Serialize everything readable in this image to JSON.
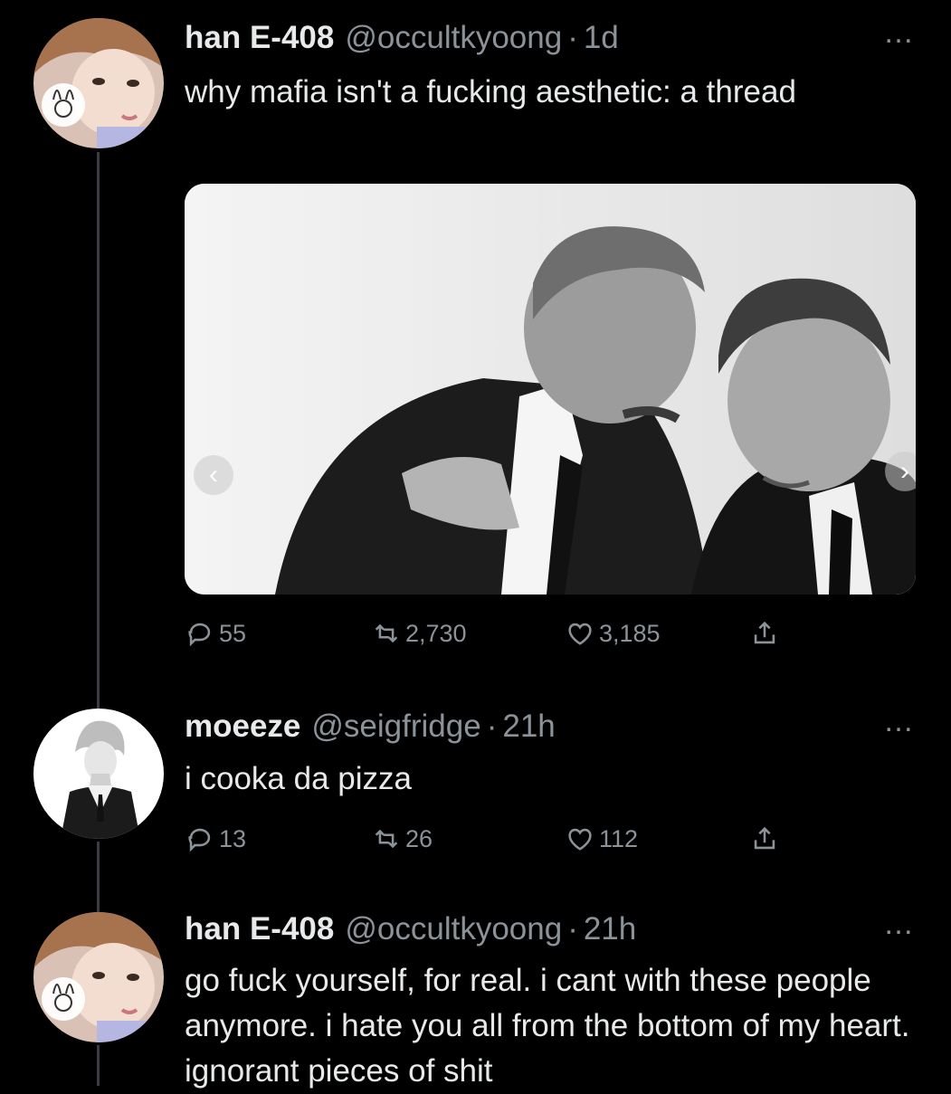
{
  "tweets": [
    {
      "name": "han E-408",
      "handle": "@occultkyoong",
      "sep": "·",
      "time": "1d",
      "text": "why mafia isn't a fucking aesthetic: a thread",
      "stats": {
        "replies": "55",
        "retweets": "2,730",
        "likes": "3,185"
      }
    },
    {
      "name": "moeeze",
      "handle": "@seigfridge",
      "sep": "·",
      "time": "21h",
      "text": "i cooka da pizza",
      "stats": {
        "replies": "13",
        "retweets": "26",
        "likes": "112"
      }
    },
    {
      "name": "han E-408",
      "handle": "@occultkyoong",
      "sep": "·",
      "time": "21h",
      "text": "go fuck yourself, for real. i cant with these people anymore. i hate you all from the bottom of my heart. ignorant pieces of shit"
    }
  ],
  "more_icon": "…",
  "icons": [
    "reply-icon",
    "retweet-icon",
    "like-icon",
    "share-icon",
    "more-icon"
  ],
  "colors": {
    "background": "#000000",
    "text": "#e7e9ea",
    "muted": "#8b9399",
    "thread_line": "#3a3d41"
  }
}
